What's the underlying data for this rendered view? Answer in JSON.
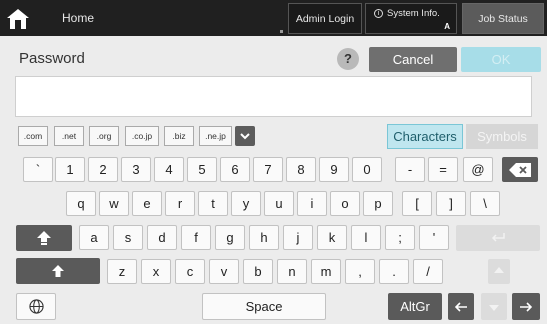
{
  "topbar": {
    "home_label": "Home",
    "admin_login": "Admin Login",
    "system_info": "System Info.",
    "system_info_sub": "A",
    "job_status": "Job Status"
  },
  "header": {
    "title": "Password",
    "help": "?",
    "cancel": "Cancel",
    "ok": "OK"
  },
  "password_field": {
    "value": ""
  },
  "domains": [
    ".com",
    ".net",
    ".org",
    ".co.jp",
    ".biz",
    ".ne.jp"
  ],
  "mode_tabs": {
    "characters": "Characters",
    "symbols": "Symbols"
  },
  "rows": {
    "row1": [
      "`",
      "1",
      "2",
      "3",
      "4",
      "5",
      "6",
      "7",
      "8",
      "9",
      "0",
      "-",
      "=",
      "@"
    ],
    "row2": [
      "q",
      "w",
      "e",
      "r",
      "t",
      "y",
      "u",
      "i",
      "o",
      "p",
      "[",
      "]",
      "\\"
    ],
    "row3": [
      "a",
      "s",
      "d",
      "f",
      "g",
      "h",
      "j",
      "k",
      "l",
      ";",
      "'"
    ],
    "row4": [
      "z",
      "x",
      "c",
      "v",
      "b",
      "n",
      "m",
      ",",
      ".",
      "/"
    ]
  },
  "bottom": {
    "space": "Space",
    "altgr": "AltGr"
  },
  "icons": {
    "home": "home-icon",
    "backspace": "backspace-icon",
    "caps_lock": "caps-lock-icon",
    "shift": "shift-icon",
    "globe": "globe-icon",
    "left": "arrow-left-icon",
    "right": "arrow-right-icon"
  }
}
